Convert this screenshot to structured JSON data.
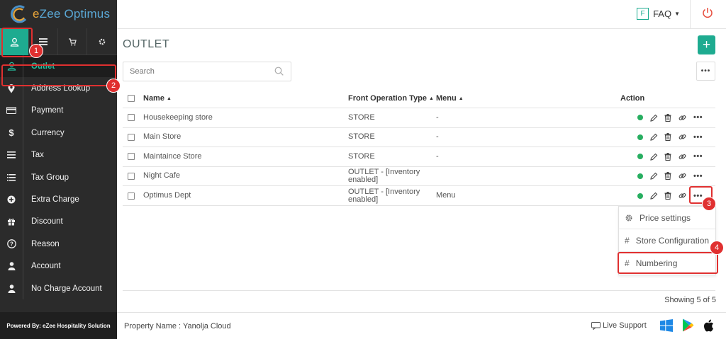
{
  "app": {
    "logo_prefix": "e",
    "logo_text": "Zee Optimus"
  },
  "top_tabs": [
    {
      "icon": "user-icon",
      "active": true
    },
    {
      "icon": "list-icon",
      "active": false
    },
    {
      "icon": "cart-icon",
      "active": false
    },
    {
      "icon": "gear-icon",
      "active": false
    }
  ],
  "sidebar": {
    "items": [
      {
        "label": "Outlet",
        "icon": "user-icon",
        "active": true
      },
      {
        "label": "Address Lookup",
        "icon": "location-pin-icon"
      },
      {
        "label": "Payment",
        "icon": "credit-card-icon"
      },
      {
        "label": "Currency",
        "icon": "dollar-icon"
      },
      {
        "label": "Tax",
        "icon": "list-icon"
      },
      {
        "label": "Tax Group",
        "icon": "list-icon"
      },
      {
        "label": "Extra Charge",
        "icon": "plus-circle-icon"
      },
      {
        "label": "Discount",
        "icon": "gift-icon"
      },
      {
        "label": "Reason",
        "icon": "question-icon"
      },
      {
        "label": "Account",
        "icon": "person-icon"
      },
      {
        "label": "No Charge Account",
        "icon": "person-icon"
      }
    ],
    "powered_by": "Powered By: eZee Hospitality Solution"
  },
  "header": {
    "faq_badge": "F",
    "faq_label": "FAQ"
  },
  "page": {
    "title": "OUTLET",
    "add_label": "+",
    "search_placeholder": "Search",
    "more_label": "•••"
  },
  "table": {
    "headers": {
      "name": "Name",
      "type": "Front Operation Type",
      "menu": "Menu",
      "action": "Action"
    },
    "rows": [
      {
        "name": "Housekeeping store",
        "type": "STORE",
        "menu": "-"
      },
      {
        "name": "Main Store",
        "type": "STORE",
        "menu": "-"
      },
      {
        "name": "Maintaince Store",
        "type": "STORE",
        "menu": "-"
      },
      {
        "name": "Night Cafe",
        "type": "OUTLET - [Inventory enabled]",
        "menu": ""
      },
      {
        "name": "Optimus Dept",
        "type": "OUTLET - [Inventory enabled]",
        "menu": "Menu"
      }
    ],
    "more_label": "•••",
    "showing": "Showing 5 of 5"
  },
  "dropdown": {
    "items": [
      {
        "label": "Price settings",
        "icon": "gear-icon"
      },
      {
        "label": "Store Configuration",
        "icon": "#"
      },
      {
        "label": "Numbering",
        "icon": "#"
      }
    ]
  },
  "footer": {
    "property": "Property Name : Yanolja Cloud",
    "live_support": "Live Support"
  },
  "annotations": [
    "1",
    "2",
    "3",
    "4"
  ],
  "colors": {
    "accent": "#1eab90",
    "sidebar_bg": "#2b2b2b",
    "annotation": "#e03030",
    "status_green": "#27ae60"
  }
}
